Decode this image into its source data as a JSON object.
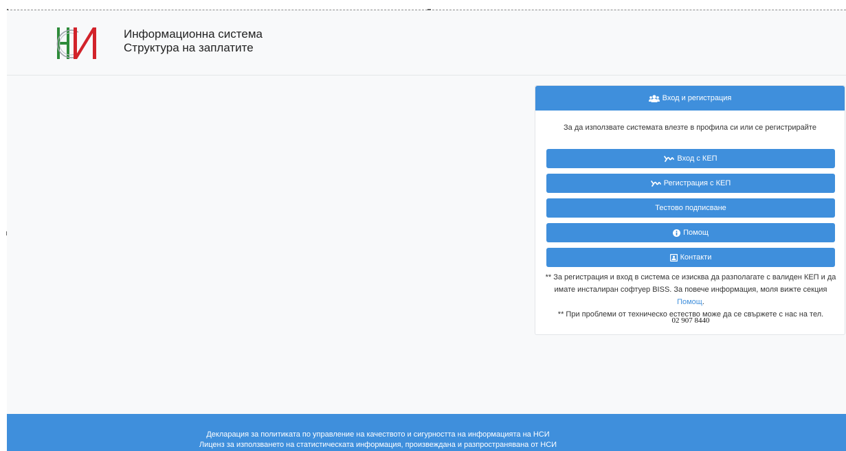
{
  "header": {
    "title_line1": "Информационна система",
    "title_line2": "Структура на заплатите"
  },
  "card": {
    "header_label": "Вход и регистрация",
    "intro_text": "За да използвате системата влезте в профила си или се регистрирайте",
    "buttons": {
      "login": "Вход с КЕП",
      "register": "Регистрация с КЕП",
      "test_sign": "Тестово подписване",
      "help": "Помощ",
      "contacts": "Контакти"
    },
    "note1_prefix": "** За регистрация и вход в система се изисква да разполагате с валиден КЕП и да имате инсталиран софтуер BISS. За повече информация, моля вижте секция",
    "note1_link": "Помощ",
    "note1_suffix": ".",
    "note2": "** При проблеми от техническо естество може да се свържете с нас на тел.",
    "phone": "02 907 8440"
  },
  "footer": {
    "link1": "Декларация за политиката по управление на качеството и сигурността на информацията на НСИ",
    "link2": "Лиценз за използването на статистическата информация, произвеждана и разпространявана от НСИ"
  },
  "colors": {
    "accent": "#3f8fdc",
    "logo_green": "#2e8b3a",
    "logo_red": "#d2232a"
  },
  "icons": {
    "card_header": "users-icon",
    "login": "signature-icon",
    "register": "signature-icon",
    "help": "info-circle-icon",
    "contacts": "address-card-icon"
  }
}
